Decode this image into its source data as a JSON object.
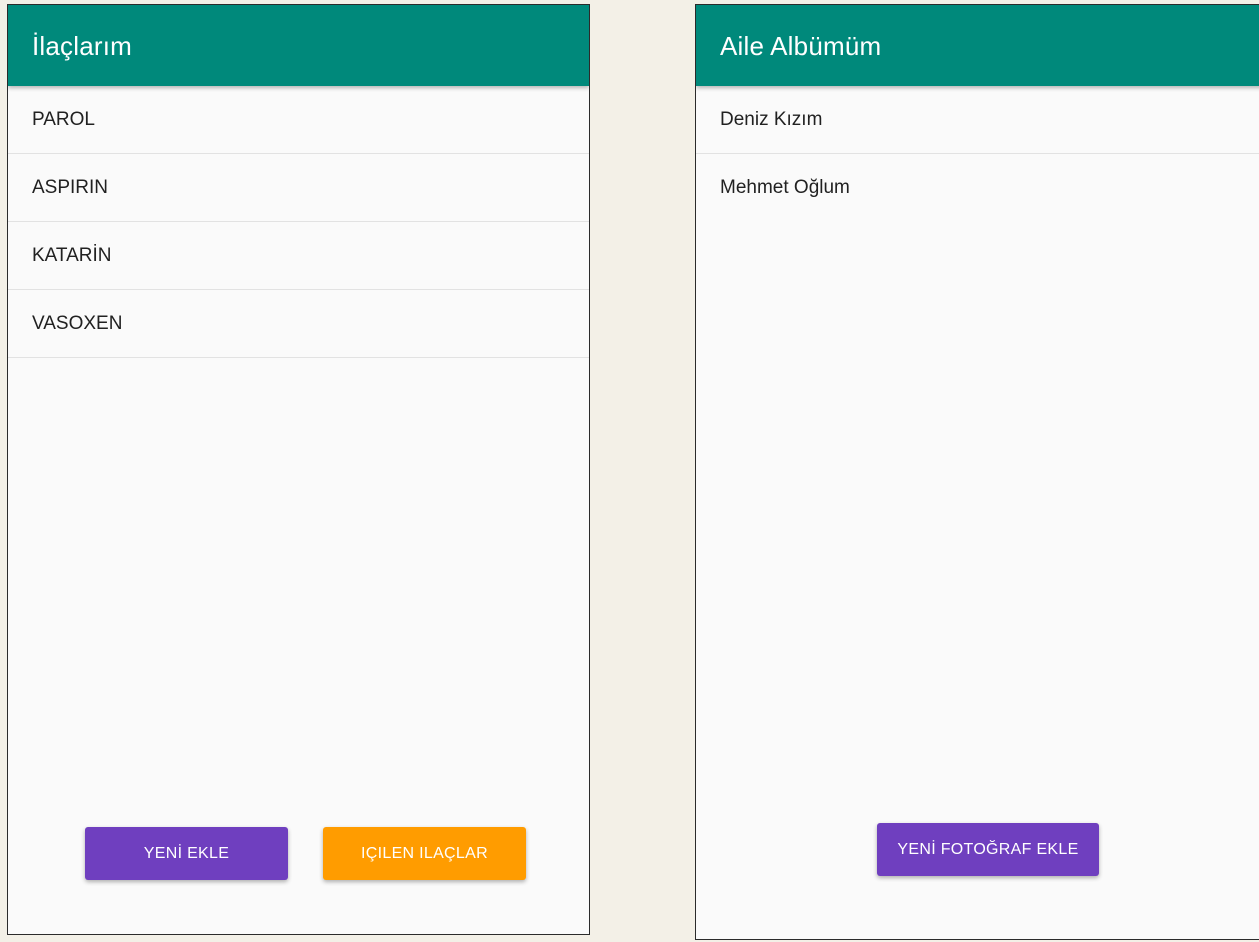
{
  "left_screen": {
    "title": "İlaçlarım",
    "items": [
      {
        "label": "PAROL"
      },
      {
        "label": "ASPIRIN"
      },
      {
        "label": "KATARİN"
      },
      {
        "label": "VASOXEN"
      }
    ],
    "buttons": {
      "add_new": "YENİ EKLE",
      "taken_meds": "IÇILEN ILAÇLAR"
    }
  },
  "right_screen": {
    "title": "Aile Albümüm",
    "items": [
      {
        "label": "Deniz Kızım"
      },
      {
        "label": "Mehmet Oğlum"
      }
    ],
    "buttons": {
      "add_photo": "YENİ FOTOĞRAF EKLE"
    }
  },
  "colors": {
    "appbar": "#00897b",
    "primary_button": "#6f3fbf",
    "accent_button": "#ff9c00",
    "background": "#f3f0e7"
  }
}
